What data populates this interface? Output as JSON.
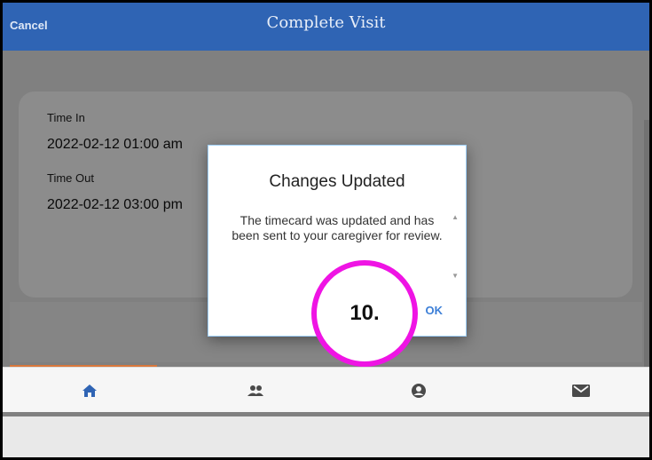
{
  "header": {
    "cancel_label": "Cancel",
    "title": "Complete Visit"
  },
  "card": {
    "time_in_label": "Time In",
    "time_in_value": "2022-02-12 01:00 am",
    "time_out_label": "Time Out",
    "time_out_value": "2022-02-12 03:00 pm"
  },
  "dialog": {
    "title": "Changes Updated",
    "message": "The timecard was updated and has been sent to your caregiver for review.",
    "ok_label": "OK"
  },
  "marker": {
    "label": "10."
  },
  "bottom_nav": {
    "icons": [
      "home-icon",
      "people-icon",
      "account-icon",
      "mail-icon"
    ],
    "accent_color": "#d9783c"
  },
  "colors": {
    "header": "#2f64b4",
    "marker_ring": "#ef14e4",
    "ok": "#3c7fd7"
  }
}
